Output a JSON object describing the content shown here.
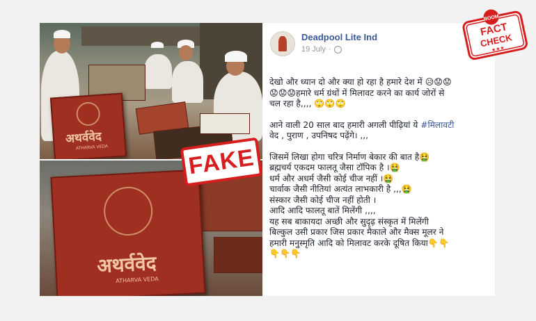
{
  "post": {
    "author": "Deadpool Lite Ind",
    "date": "19 July",
    "separator": "·",
    "lines": [
      "देखो और ध्यान दो और क्या हो रहा है हमारे देश में 😥😟😟",
      "😟😟😟हमारे धर्म ग्रंथों में मिलावट करने का कार्य जोरों से",
      "चल रहा है,,,, 🙄🙄🙄"
    ],
    "para2_prefix": "आने वाली 20 साल बाद हमारी अगली पीढ़ियां ये ",
    "para2_hashtag": "#मिलावटी",
    "para2_rest": "वेद , पुराण , उपनिषद पढ़ेंगे। ,,,",
    "para3": [
      "जिसमें लिखा होगा चरित्र निर्माण बेकार की बात है🤮",
      "ब्रह्मचर्य एकदम फालतू जैसा टॉपिक है ।🤮",
      "धर्म और अधर्म जैसी कोई चीज नहीं ।🤮",
      "चार्वाक जैसी नीतियां अत्यंत लाभकारी है ,,,🤮",
      "संस्कार जैसी कोई चीज नहीं होती ।",
      "आदि आदि फालतू बातें मिलेंगी ,,,,",
      "यह सब बाकायदा अच्छी और सुदृढ़ संस्कृत में मिलेंगी",
      "बिल्कुल उसी प्रकार जिस प्रकार मैकाले और मैक्स मूलर ने",
      "हमारी मनुस्मृति आदि को मिलावट करके दूषित किया👇👇",
      "👇👇👇"
    ]
  },
  "image": {
    "book_title": "अथर्ववेद",
    "book_subtitle": "ATHARVA VEDA",
    "stamp": "FAKE"
  },
  "badge": {
    "top": "BOOM",
    "line1": "FACT",
    "line2": "CHECK",
    "stars": "★★★"
  },
  "colors": {
    "accent_link": "#385898",
    "stamp_red": "#d61e1e"
  }
}
